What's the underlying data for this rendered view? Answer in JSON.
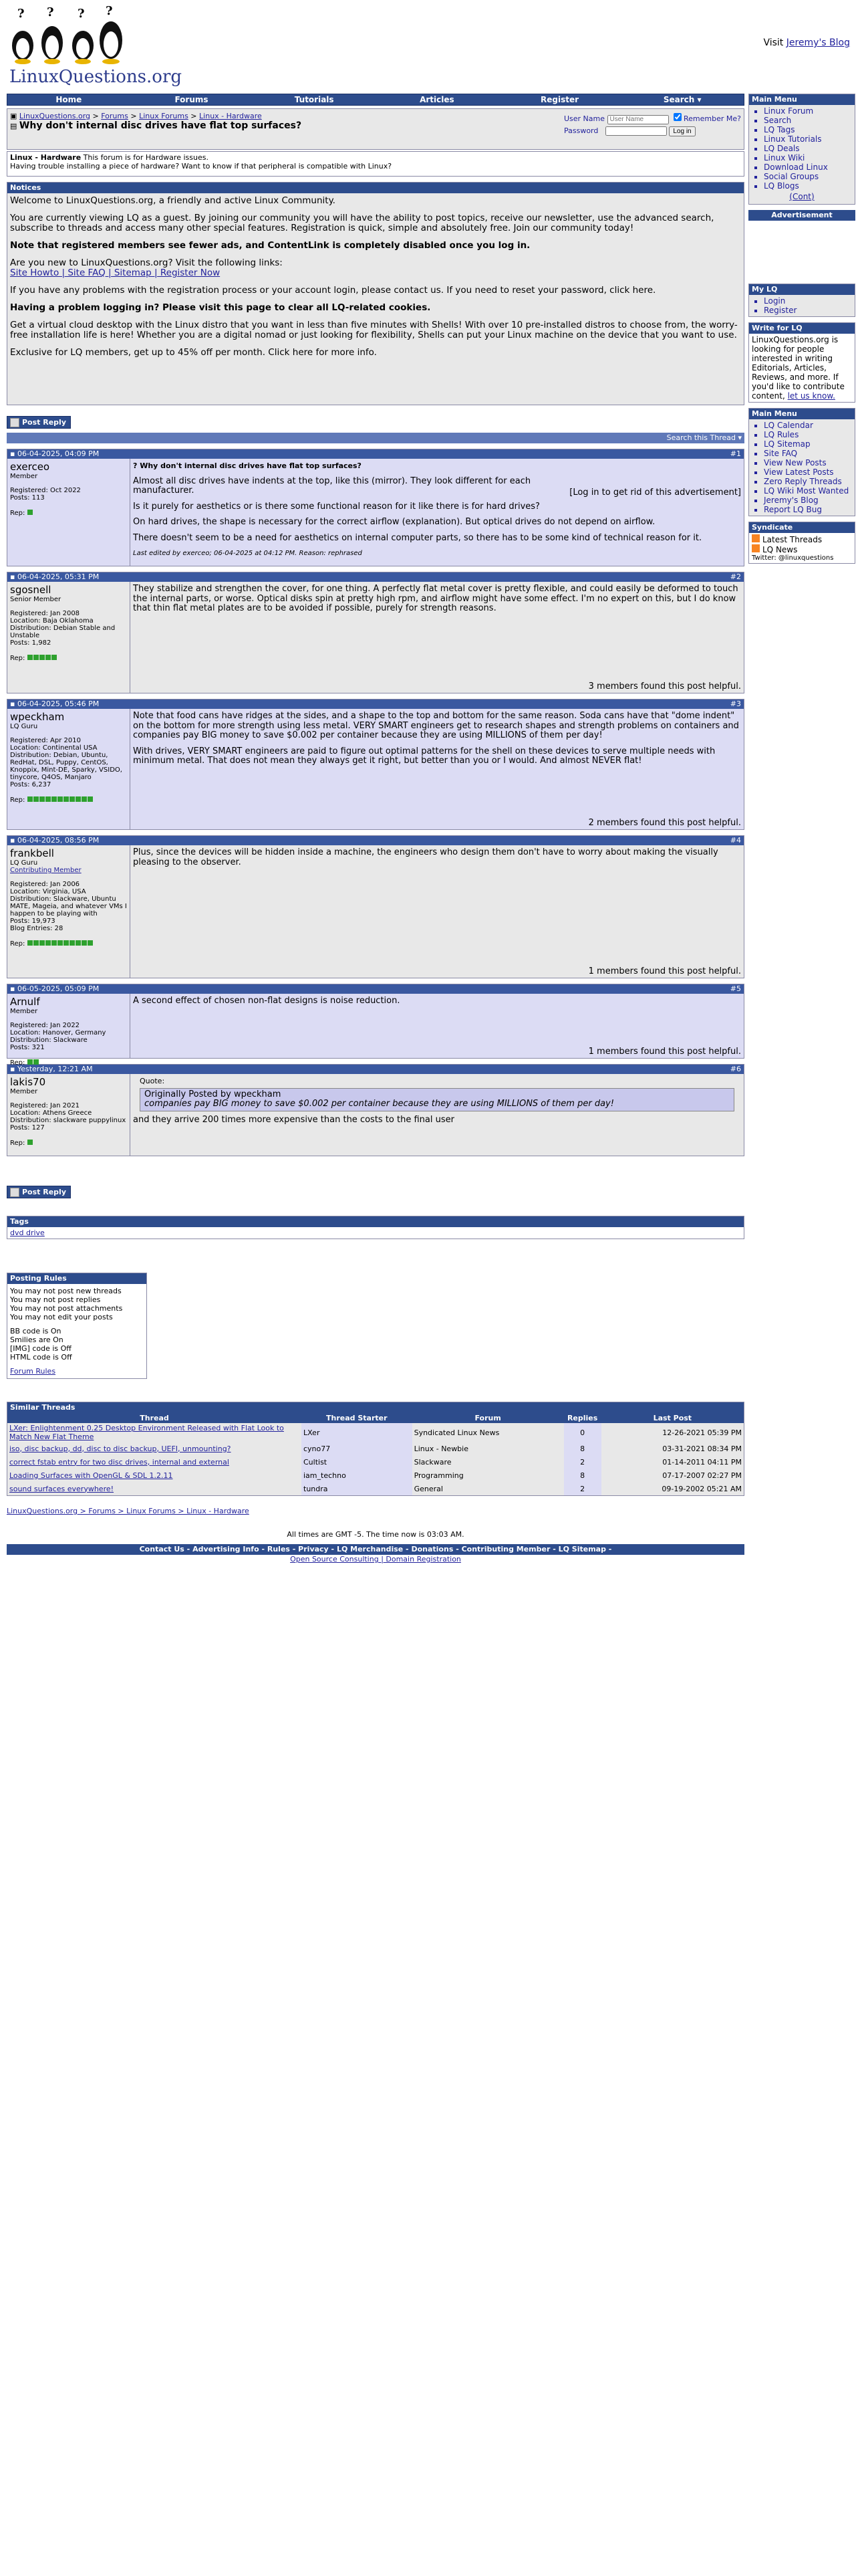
{
  "header": {
    "logo_text": "LinuxQuestions.org",
    "visit_text": "Visit ",
    "visit_link": "Jeremy's Blog"
  },
  "navbar": [
    "Home",
    "Forums",
    "Tutorials",
    "Articles",
    "Register",
    "Search"
  ],
  "breadcrumb": {
    "items": [
      "LinuxQuestions.org",
      "Forums",
      "Linux Forums",
      "Linux - Hardware"
    ],
    "sep": " > ",
    "title": "Why don't internal disc drives have flat top surfaces?"
  },
  "login": {
    "username_label": "User Name",
    "username_placeholder": "User Name",
    "remember_label": "Remember Me?",
    "password_label": "Password",
    "button": "Log in"
  },
  "forum": {
    "name": "Linux - Hardware",
    "desc1": "This forum is for Hardware issues.",
    "desc2": "Having trouble installing a piece of hardware? Want to know if that peripheral is compatible with Linux?"
  },
  "notices": {
    "title": "Notices",
    "welcome": "Welcome to LinuxQuestions.org, a friendly and active Linux Community.",
    "guest": "You are currently viewing LQ as a guest. By joining our community you will have the ability to post topics, receive our newsletter, use the advanced search, subscribe to threads and access many other special features. Registration is quick, simple and absolutely free. Join our community today!",
    "note": "Note that registered members see fewer ads, and ContentLink is completely disabled once you log in.",
    "new_q": "Are you new to LinuxQuestions.org? Visit the following links:",
    "new_links": "Site Howto | Site FAQ | Sitemap | Register Now",
    "problems": "If you have any problems with the registration process or your account login, please contact us. If you need to reset your password, click here.",
    "problem_login": "Having a problem logging in? Please visit this page to clear all LQ-related cookies.",
    "desktop": "Get a virtual cloud desktop with the Linux distro that you want in less than five minutes with Shells! With over 10 pre-installed distros to choose from, the worry-free installation life is here! Whether you are a digital nomad or just looking for flexibility, Shells can put your Linux machine on the device that you want to use.",
    "exclusive": "Exclusive for LQ members, get up to 45% off per month. Click here for more info."
  },
  "reply_button": "Post Reply",
  "search_thread": "Search this Thread",
  "posts": [
    {
      "date": "06-04-2025, 04:09 PM",
      "num": "#1",
      "user": "exerceo",
      "role": "Member",
      "info": [
        "Registered: Oct 2022",
        "Posts: 113"
      ],
      "rep": 1,
      "title": "Why don't internal disc drives have flat top surfaces?",
      "body": [
        "Almost all disc drives have indents at the top, like this (mirror). They look different for each manufacturer.",
        "Is it purely for aesthetics or is there some functional reason for it like there is for hard drives?",
        "On hard drives, the shape is necessary for the correct airflow (explanation). But optical drives do not depend on airflow.",
        "There doesn't seem to be a need for aesthetics on internal computer parts, so there has to be some kind of technical reason for it."
      ],
      "edited": "Last edited by exerceo; 06-04-2025 at 04:12 PM. Reason: rephrased",
      "ad": "[Log in to get rid of this advertisement]",
      "helpful": ""
    },
    {
      "date": "06-04-2025, 05:31 PM",
      "num": "#2",
      "user": "sgosnell",
      "role": "Senior Member",
      "info": [
        "Registered: Jan 2008",
        "Location: Baja Oklahoma",
        "Distribution: Debian Stable and Unstable",
        "Posts: 1,982"
      ],
      "rep": 5,
      "body": [
        "They stabilize and strengthen the cover, for one thing. A perfectly flat metal cover is pretty flexible, and could easily be deformed to touch the internal parts, or worse. Optical disks spin at pretty high rpm, and airflow might have some effect. I'm no expert on this, but I do know that thin flat metal plates are to be avoided if possible, purely for strength reasons."
      ],
      "helpful": "3 members found this post helpful."
    },
    {
      "date": "06-04-2025, 05:46 PM",
      "num": "#3",
      "user": "wpeckham",
      "role": "LQ Guru",
      "info": [
        "Registered: Apr 2010",
        "Location: Continental USA",
        "Distribution: Debian, Ubuntu, RedHat, DSL, Puppy, CentOS, Knoppix, Mint-DE, Sparky, VSIDO, tinycore, Q4OS, Manjaro",
        "Posts: 6,237"
      ],
      "rep": 11,
      "body": [
        "Note that food cans have ridges at the sides, and a shape to the top and bottom for the same reason. Soda cans have that \"dome indent\" on the bottom for more strength using less metal. VERY SMART engineers get to research shapes and strength problems on containers and companies pay BIG money to save $0.002 per container because they are using MILLIONS of them per day!",
        "With drives, VERY SMART engineers are paid to figure out optimal patterns for the shell on these devices to serve multiple needs with minimum metal. That does not mean they always get it right, but better than you or I would. And almost NEVER flat!"
      ],
      "helpful": "2 members found this post helpful."
    },
    {
      "date": "06-04-2025, 08:56 PM",
      "num": "#4",
      "user": "frankbell",
      "role": "LQ Guru",
      "role2": "Contributing Member",
      "info": [
        "Registered: Jan 2006",
        "Location: Virginia, USA",
        "Distribution: Slackware, Ubuntu MATE, Mageia, and whatever VMs I happen to be playing with",
        "Posts: 19,973",
        "Blog Entries: 28"
      ],
      "rep": 11,
      "body": [
        "Plus, since the devices will be hidden inside a machine, the engineers who design them don't have to worry about making the visually pleasing to the observer."
      ],
      "helpful": "1 members found this post helpful."
    },
    {
      "date": "06-05-2025, 05:09 PM",
      "num": "#5",
      "user": "Arnulf",
      "role": "Member",
      "info": [
        "Registered: Jan 2022",
        "Location: Hanover, Germany",
        "Distribution: Slackware",
        "Posts: 321"
      ],
      "rep": 2,
      "body": [
        "A second effect of chosen non-flat designs is noise reduction."
      ],
      "helpful": "1 members found this post helpful."
    },
    {
      "date": "Yesterday, 12:21 AM",
      "num": "#6",
      "user": "lakis70",
      "role": "Member",
      "info": [
        "Registered: Jan 2021",
        "Location: Athens Greece",
        "Distribution: slackware puppylinux",
        "Posts: 127"
      ],
      "rep": 1,
      "quote_label": "Quote:",
      "quote_by": "Originally Posted by wpeckham",
      "quote_text": "companies pay BIG money to save $0.002 per container because they are using MILLIONS of them per day!",
      "body": [
        "and they arrive 200 times more expensive than the costs to the final user"
      ],
      "helpful": ""
    }
  ],
  "tags": {
    "title": "Tags",
    "items": [
      "dvd drive"
    ]
  },
  "posting_rules": {
    "title": "Posting Rules",
    "lines": [
      "You may not post new threads",
      "You may not post replies",
      "You may not post attachments",
      "You may not edit your posts"
    ],
    "codes": [
      "BB code is On",
      "Smilies are On",
      "[IMG] code is Off",
      "HTML code is Off"
    ],
    "forum_rules": "Forum Rules"
  },
  "similar": {
    "title": "Similar Threads",
    "headers": [
      "Thread",
      "Thread Starter",
      "Forum",
      "Replies",
      "Last Post"
    ],
    "rows": [
      [
        "LXer: Enlightenment 0.25 Desktop Environment Released with Flat Look to Match New Flat Theme",
        "LXer",
        "Syndicated Linux News",
        "0",
        "12-26-2021 05:39 PM"
      ],
      [
        "iso, disc backup, dd, disc to disc backup, UEFI, unmounting?",
        "cyno77",
        "Linux - Newbie",
        "8",
        "03-31-2021 08:34 PM"
      ],
      [
        "correct fstab entry for two disc drives, internal and external",
        "Cultist",
        "Slackware",
        "2",
        "01-14-2011 04:11 PM"
      ],
      [
        "Loading Surfaces with OpenGL & SDL 1.2.11",
        "iam_techno",
        "Programming",
        "8",
        "07-17-2007 02:27 PM"
      ],
      [
        "sound surfaces everywhere!",
        "tundra",
        "General",
        "2",
        "09-19-2002 05:21 AM"
      ]
    ]
  },
  "bottom_crumb": "LinuxQuestions.org > Forums > Linux Forums > Linux - Hardware",
  "times": "All times are GMT -5. The time now is 03:03 AM.",
  "footer_links": "Contact Us - Advertising Info - Rules - Privacy - LQ Merchandise - Donations - Contributing Member - LQ Sitemap -",
  "footer_sub": "Open Source Consulting | Domain Registration",
  "sidebar": {
    "main_menu": {
      "title": "Main Menu",
      "items": [
        "Linux Forum",
        "Search",
        "LQ Tags",
        "Linux Tutorials",
        "LQ Deals",
        "Linux Wiki",
        "Download Linux",
        "Social Groups",
        "LQ Blogs"
      ],
      "cont": "(Cont)"
    },
    "advert": "Advertisement",
    "my_lq": {
      "title": "My LQ",
      "items": [
        "Login",
        "Register"
      ]
    },
    "write": {
      "title": "Write for LQ",
      "text": "LinuxQuestions.org is looking for people interested in writing Editorials, Articles, Reviews, and more. If you'd like to contribute content, ",
      "link": "let us know."
    },
    "main_menu2": {
      "title": "Main Menu",
      "items": [
        "LQ Calendar",
        "LQ Rules",
        "LQ Sitemap",
        "Site FAQ",
        "View New Posts",
        "View Latest Posts",
        "Zero Reply Threads",
        "LQ Wiki Most Wanted",
        "Jeremy's Blog",
        "Report LQ Bug"
      ]
    },
    "syndicate": {
      "title": "Syndicate",
      "items": [
        "Latest Threads",
        "LQ News"
      ],
      "twitter": "Twitter: @linuxquestions"
    }
  }
}
